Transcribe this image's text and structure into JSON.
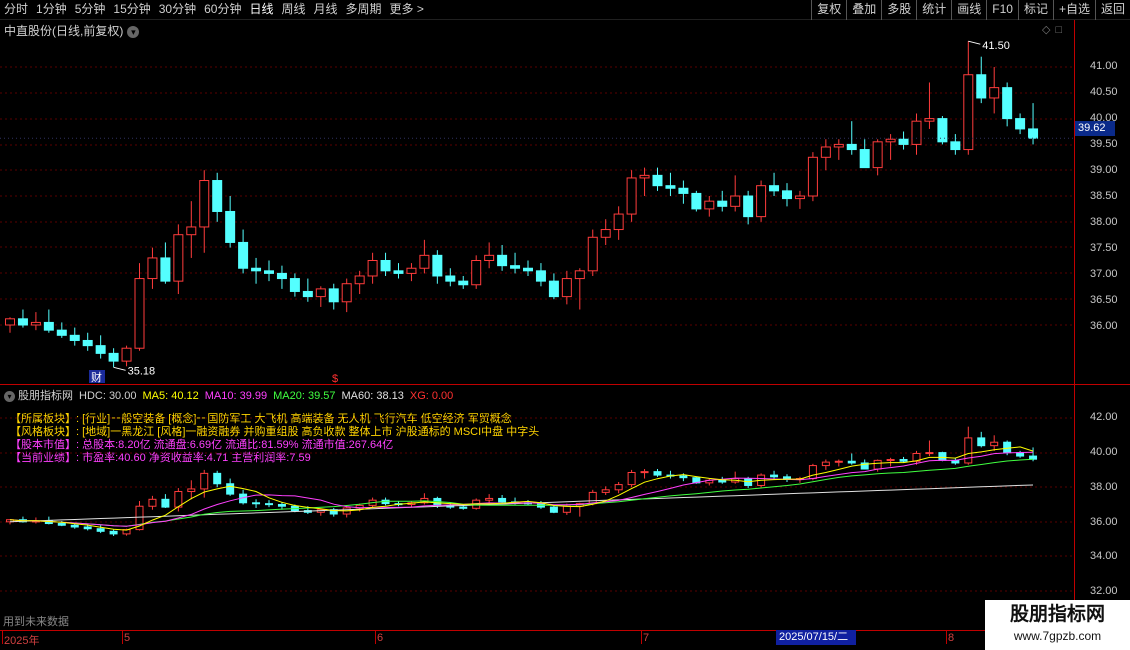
{
  "toolbar": {
    "periods": [
      "分时",
      "1分钟",
      "5分钟",
      "15分钟",
      "30分钟",
      "60分钟",
      "日线",
      "周线",
      "月线",
      "多周期"
    ],
    "more": "更多 >",
    "active_period": "日线",
    "actions": [
      "复权",
      "叠加",
      "多股",
      "统计",
      "画线",
      "F10",
      "标记",
      "+自选",
      "返回"
    ]
  },
  "price_panel": {
    "title": "中直股份(日线,前复权)",
    "price_axis": [
      "41.00",
      "40.50",
      "40.00",
      "39.50",
      "39.00",
      "38.50",
      "38.00",
      "37.50",
      "37.00",
      "36.50",
      "36.00"
    ],
    "current_price": "39.62",
    "high_marker": "41.50",
    "low_marker": "35.18",
    "fin_marker": "财",
    "s_marker": "$"
  },
  "indicator": {
    "name": "股朋指标网",
    "hdc": "HDC: 30.00",
    "ma5": "MA5: 40.12",
    "ma10": "MA10: 39.99",
    "ma20": "MA20: 39.57",
    "ma60": "MA60: 38.13",
    "xg": "XG: 0.00",
    "axis": [
      "42.00",
      "40.00",
      "38.00",
      "36.00",
      "34.00",
      "32.00"
    ],
    "info": [
      "【所属板块】: [行业]一般空装备 [概念]一国防军工 大飞机 高端装备 无人机 飞行汽车 低空经济 军贸概念",
      "【风格板块】: [地域]一黑龙江 [风格]一融资融券 并购重组股 高负收款 整体上市 沪股通标的 MSCI中盘 中字头",
      "【股本市值】: 总股本:8.20亿 流通盘:6.69亿 流通比:81.59% 流通市值:267.64亿",
      "【当前业绩】: 市盈率:40.60 净资收益率:4.71 主营利润率:7.59"
    ],
    "future_note": "用到未来数据"
  },
  "date_axis": {
    "labels": [
      "2025年",
      "5",
      "6",
      "7",
      "8"
    ],
    "cursor": "2025/07/15/二"
  },
  "watermark": {
    "name": "股朋指标网",
    "url": "www.7gpzb.com"
  },
  "colors": {
    "up": "#ff3c3c",
    "down": "#54ffff",
    "ma5": "#ffff00",
    "ma10": "#ff40ff",
    "ma20": "#40ff40",
    "ma60": "#e0e0e0",
    "xg": "#ff3030"
  },
  "chart_data": {
    "type": "candlestick",
    "series": [
      {
        "name": "K",
        "ohlc": [
          [
            36.0,
            36.15,
            35.85,
            36.12
          ],
          [
            36.12,
            36.3,
            35.95,
            36.0
          ],
          [
            36.0,
            36.25,
            35.9,
            36.05
          ],
          [
            36.05,
            36.3,
            35.85,
            35.9
          ],
          [
            35.9,
            36.05,
            35.75,
            35.8
          ],
          [
            35.8,
            35.95,
            35.6,
            35.7
          ],
          [
            35.7,
            35.85,
            35.5,
            35.6
          ],
          [
            35.6,
            35.8,
            35.35,
            35.45
          ],
          [
            35.45,
            35.55,
            35.18,
            35.3
          ],
          [
            35.3,
            35.6,
            35.2,
            35.55
          ],
          [
            35.55,
            37.2,
            35.5,
            36.9
          ],
          [
            36.9,
            37.5,
            36.7,
            37.3
          ],
          [
            37.3,
            37.6,
            36.8,
            36.85
          ],
          [
            36.85,
            37.95,
            36.6,
            37.75
          ],
          [
            37.75,
            38.4,
            37.3,
            37.9
          ],
          [
            37.9,
            39.0,
            37.4,
            38.8
          ],
          [
            38.8,
            38.95,
            38.0,
            38.2
          ],
          [
            38.2,
            38.5,
            37.5,
            37.6
          ],
          [
            37.6,
            37.85,
            37.0,
            37.1
          ],
          [
            37.1,
            37.3,
            36.8,
            37.05
          ],
          [
            37.05,
            37.25,
            36.85,
            37.0
          ],
          [
            37.0,
            37.15,
            36.7,
            36.9
          ],
          [
            36.9,
            37.0,
            36.55,
            36.65
          ],
          [
            36.65,
            36.9,
            36.45,
            36.55
          ],
          [
            36.55,
            36.75,
            36.35,
            36.7
          ],
          [
            36.7,
            36.8,
            36.3,
            36.45
          ],
          [
            36.45,
            36.9,
            36.25,
            36.8
          ],
          [
            36.8,
            37.05,
            36.6,
            36.95
          ],
          [
            36.95,
            37.4,
            36.8,
            37.25
          ],
          [
            37.25,
            37.4,
            36.95,
            37.05
          ],
          [
            37.05,
            37.2,
            36.9,
            37.0
          ],
          [
            37.0,
            37.2,
            36.85,
            37.1
          ],
          [
            37.1,
            37.65,
            37.0,
            37.35
          ],
          [
            37.35,
            37.45,
            36.8,
            36.95
          ],
          [
            36.95,
            37.1,
            36.75,
            36.85
          ],
          [
            36.85,
            36.95,
            36.7,
            36.78
          ],
          [
            36.78,
            37.35,
            36.7,
            37.25
          ],
          [
            37.25,
            37.6,
            37.1,
            37.35
          ],
          [
            37.35,
            37.55,
            37.05,
            37.15
          ],
          [
            37.15,
            37.4,
            37.0,
            37.1
          ],
          [
            37.1,
            37.25,
            36.95,
            37.05
          ],
          [
            37.05,
            37.2,
            36.75,
            36.85
          ],
          [
            36.85,
            37.0,
            36.5,
            36.55
          ],
          [
            36.55,
            37.05,
            36.4,
            36.9
          ],
          [
            36.9,
            37.1,
            36.3,
            37.05
          ],
          [
            37.05,
            37.85,
            36.95,
            37.7
          ],
          [
            37.7,
            38.05,
            37.55,
            37.85
          ],
          [
            37.85,
            38.3,
            37.65,
            38.15
          ],
          [
            38.15,
            39.0,
            38.0,
            38.85
          ],
          [
            38.85,
            39.05,
            38.5,
            38.9
          ],
          [
            38.9,
            39.05,
            38.6,
            38.7
          ],
          [
            38.7,
            38.95,
            38.5,
            38.65
          ],
          [
            38.65,
            38.8,
            38.35,
            38.55
          ],
          [
            38.55,
            38.6,
            38.2,
            38.25
          ],
          [
            38.25,
            38.5,
            38.1,
            38.4
          ],
          [
            38.4,
            38.6,
            38.2,
            38.3
          ],
          [
            38.3,
            38.9,
            38.2,
            38.5
          ],
          [
            38.5,
            38.6,
            37.95,
            38.1
          ],
          [
            38.1,
            38.8,
            38.0,
            38.7
          ],
          [
            38.7,
            38.95,
            38.5,
            38.6
          ],
          [
            38.6,
            38.75,
            38.3,
            38.45
          ],
          [
            38.45,
            38.6,
            38.25,
            38.5
          ],
          [
            38.5,
            39.35,
            38.4,
            39.25
          ],
          [
            39.25,
            39.6,
            39.0,
            39.45
          ],
          [
            39.45,
            39.6,
            39.2,
            39.5
          ],
          [
            39.5,
            39.95,
            39.3,
            39.4
          ],
          [
            39.4,
            39.6,
            39.05,
            39.05
          ],
          [
            39.05,
            39.6,
            38.9,
            39.55
          ],
          [
            39.55,
            39.7,
            39.2,
            39.6
          ],
          [
            39.6,
            39.75,
            39.4,
            39.5
          ],
          [
            39.5,
            40.1,
            39.3,
            39.95
          ],
          [
            39.95,
            40.7,
            39.8,
            40.0
          ],
          [
            40.0,
            40.05,
            39.5,
            39.55
          ],
          [
            39.55,
            39.7,
            39.3,
            39.4
          ],
          [
            39.4,
            41.5,
            39.3,
            40.85
          ],
          [
            40.85,
            41.2,
            40.3,
            40.4
          ],
          [
            40.4,
            41.0,
            40.1,
            40.6
          ],
          [
            40.6,
            40.7,
            39.85,
            40.0
          ],
          [
            40.0,
            40.1,
            39.7,
            39.8
          ],
          [
            39.8,
            40.3,
            39.5,
            39.62
          ]
        ]
      }
    ],
    "ylim": [
      35.0,
      41.6
    ]
  }
}
